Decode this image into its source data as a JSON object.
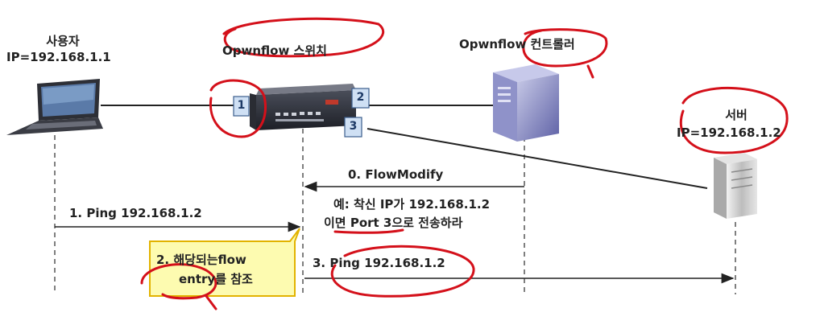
{
  "nodes": {
    "user": {
      "title": "사용자",
      "ip": "IP=192.168.1.1"
    },
    "switch": {
      "title": "Opwnflow 스위치"
    },
    "controller": {
      "title": "Opwnflow 컨트롤러"
    },
    "server": {
      "title": "서버",
      "ip": "IP=192.168.1.2"
    }
  },
  "ports": [
    "1",
    "2",
    "3"
  ],
  "messages": {
    "flow_modify": "0. FlowModify",
    "flow_modify_example_line1": "예: 착신 IP가 192.168.1.2",
    "flow_modify_example_line2": "이면 Port 3으로 전송하라",
    "ping1": "1. Ping 192.168.1.2",
    "callout_line1": "2. 해당되는flow",
    "callout_line2": "entry를 참조",
    "ping3": "3. Ping 192.168.1.2"
  },
  "colors": {
    "annotation_red": "#d4101a",
    "port_box": "#cfe0f4",
    "callout_fill": "#fdfbb0",
    "callout_border": "#e2b300",
    "arrow": "#222222"
  },
  "icons": {
    "user": "laptop-icon",
    "switch": "network-switch-icon",
    "controller": "server-tower-icon",
    "server": "server-rack-icon"
  }
}
